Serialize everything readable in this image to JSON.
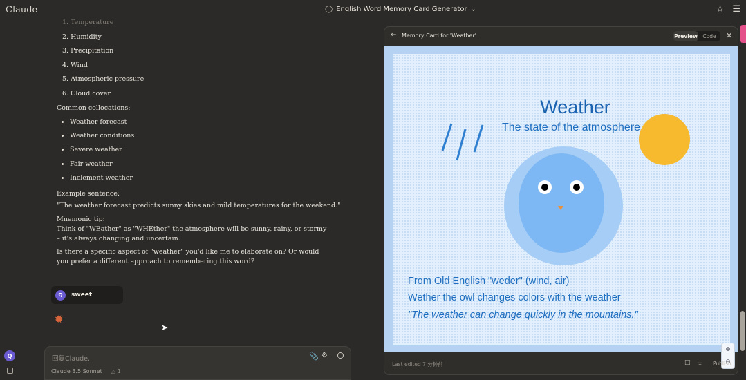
{
  "app": {
    "brand": "Claude",
    "conversation_title": "English Word Memory Card Generator"
  },
  "chat": {
    "factors": [
      "1. Temperature",
      "2. Humidity",
      "3. Precipitation",
      "4. Wind",
      "5. Atmospheric pressure",
      "6. Cloud cover"
    ],
    "collocations_label": "Common collocations:",
    "collocations": [
      "Weather forecast",
      "Weather conditions",
      "Severe weather",
      "Fair weather",
      "Inclement weather"
    ],
    "example_label": "Example sentence:",
    "example_text": "\"The weather forecast predicts sunny skies and mild temperatures for the weekend.\"",
    "mnemonic_label": "Mnemonic tip:",
    "mnemonic_text": "Think of \"WEather\" as \"WHEther\" the atmosphere will be sunny, rainy, or stormy – it's always changing and uncertain.",
    "question_text": "Is there a specific aspect of \"weather\" you'd like me to elaborate on? Or would you prefer a different approach to remembering this word?",
    "user_initial": "Q",
    "user_message": "sweet"
  },
  "composer": {
    "placeholder": "Claude...",
    "placeholder_prefix": "回复",
    "model": "Claude 3.5 Sonnet",
    "attachment_count": "1"
  },
  "artifact": {
    "title": "Memory Card for 'Weather'",
    "tab_preview": "Preview",
    "tab_code": "Code",
    "footer_left": "Last edited 7 分钟前",
    "publish_label": "Publish",
    "card": {
      "word": "Weather",
      "definition": "The state of the atmosphere",
      "etymology": "From Old English \"weder\" (wind, air)",
      "mnemonic": "Wether the owl changes colors with the weather",
      "example": "\"The weather can change quickly in the mountains.\""
    }
  },
  "colors": {
    "background": "#2b2a28",
    "card_text": "#1f6fc0",
    "sun": "#f7b92e",
    "owl_body": "#7db8f4",
    "avatar": "#6b5bd2",
    "spark": "#d9653b"
  }
}
